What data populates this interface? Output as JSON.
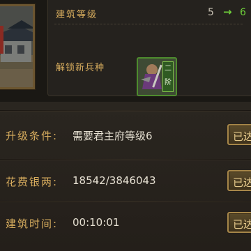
{
  "header": {
    "level_label": "建筑等级",
    "level_from": "5",
    "level_to": "6",
    "unlock_label": "解锁新兵种",
    "unit_tag": "二阶"
  },
  "rows": [
    {
      "label": "升级条件:",
      "value": "需要君主府等级6",
      "status": "已达"
    },
    {
      "label": "花费银两:",
      "value": "18542/3846043",
      "status": "已达"
    },
    {
      "label": "建筑时间:",
      "value": "00:10:01",
      "status": "已达"
    }
  ],
  "colors": {
    "label_gold": "#d8ad5e",
    "level_green": "#6fcf3a",
    "panel_bg": "#1f1c18"
  },
  "icons": {
    "building": "building-icon",
    "arrow": "arrow-right-icon",
    "unit": "soldier-unit-icon"
  }
}
